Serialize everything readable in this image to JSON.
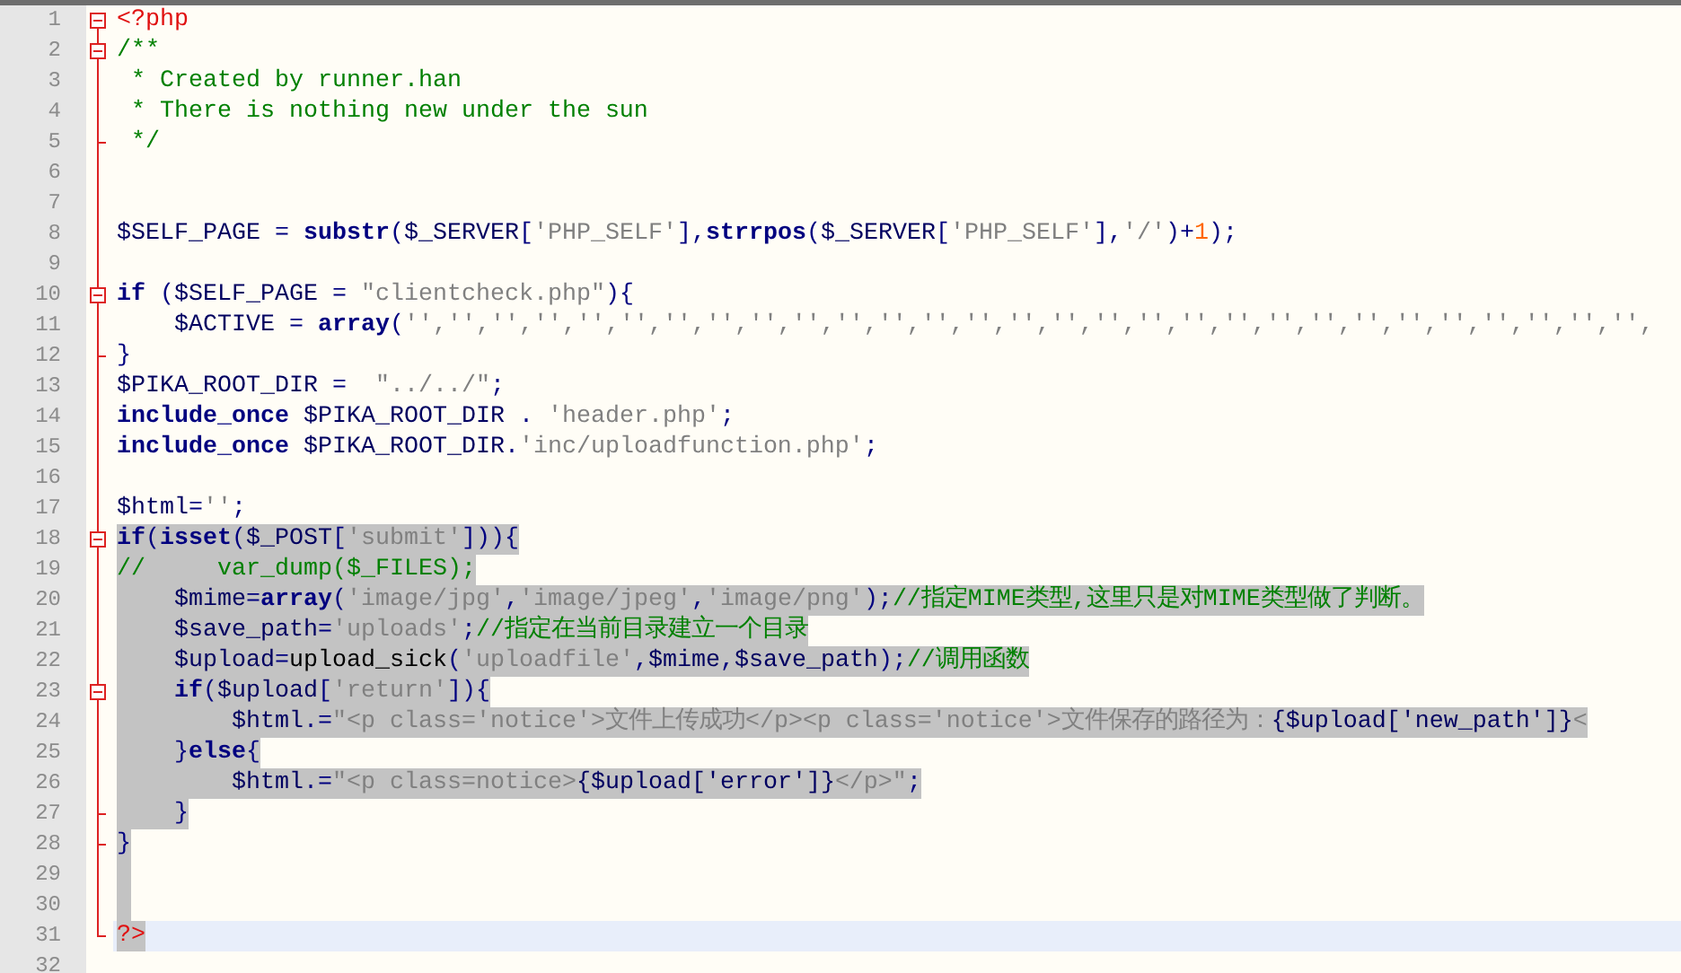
{
  "lines": [
    {
      "number": "1",
      "kind": "start",
      "selected": false,
      "current": false,
      "tokens": [
        {
          "kind": "tag",
          "text": "<?php"
        }
      ]
    },
    {
      "number": "2",
      "kind": "start",
      "selected": false,
      "current": false,
      "tokens": [
        {
          "kind": "comment",
          "text": "/**"
        }
      ]
    },
    {
      "number": "3",
      "kind": "body",
      "selected": false,
      "current": false,
      "tokens": [
        {
          "kind": "comment",
          "text": " * Created by runner.han"
        }
      ]
    },
    {
      "number": "4",
      "kind": "body",
      "selected": false,
      "current": false,
      "tokens": [
        {
          "kind": "comment",
          "text": " * There is nothing new under the sun"
        }
      ]
    },
    {
      "number": "5",
      "kind": "end",
      "selected": false,
      "current": false,
      "tokens": [
        {
          "kind": "comment",
          "text": " */"
        }
      ]
    },
    {
      "number": "6",
      "kind": "body",
      "selected": false,
      "current": false
    },
    {
      "number": "7",
      "kind": "body",
      "selected": false,
      "current": false
    },
    {
      "number": "8",
      "kind": "body",
      "selected": false,
      "current": false,
      "tokens": [
        {
          "kind": "var",
          "text": "$SELF_PAGE"
        },
        {
          "kind": "op",
          "text": " = "
        },
        {
          "kind": "keyword",
          "text": "substr"
        },
        {
          "kind": "op",
          "text": "("
        },
        {
          "kind": "var",
          "text": "$_SERVER"
        },
        {
          "kind": "op",
          "text": "["
        },
        {
          "kind": "string",
          "text": "'PHP_SELF'"
        },
        {
          "kind": "op",
          "text": "],"
        },
        {
          "kind": "keyword",
          "text": "strrpos"
        },
        {
          "kind": "op",
          "text": "("
        },
        {
          "kind": "var",
          "text": "$_SERVER"
        },
        {
          "kind": "op",
          "text": "["
        },
        {
          "kind": "string",
          "text": "'PHP_SELF'"
        },
        {
          "kind": "op",
          "text": "],"
        },
        {
          "kind": "string",
          "text": "'/'"
        },
        {
          "kind": "op",
          "text": ")+"
        },
        {
          "kind": "number",
          "text": "1"
        },
        {
          "kind": "op",
          "text": ");"
        }
      ]
    },
    {
      "number": "9",
      "kind": "body",
      "selected": false,
      "current": false
    },
    {
      "number": "10",
      "kind": "start",
      "selected": false,
      "current": false,
      "tokens": [
        {
          "kind": "keyword",
          "text": "if"
        },
        {
          "kind": "op",
          "text": " ("
        },
        {
          "kind": "var",
          "text": "$SELF_PAGE"
        },
        {
          "kind": "op",
          "text": " = "
        },
        {
          "kind": "string",
          "text": "\"clientcheck.php\""
        },
        {
          "kind": "op",
          "text": "){"
        }
      ]
    },
    {
      "number": "11",
      "kind": "body",
      "selected": false,
      "current": false,
      "tokens": [
        {
          "kind": "var",
          "text": "    $ACTIVE"
        },
        {
          "kind": "op",
          "text": " = "
        },
        {
          "kind": "keyword",
          "text": "array"
        },
        {
          "kind": "op",
          "text": "("
        },
        {
          "kind": "string",
          "text": "'','','','','','','','','','','','','','','','','','','','','','','','','','','','','',"
        }
      ]
    },
    {
      "number": "12",
      "kind": "end",
      "selected": false,
      "current": false,
      "tokens": [
        {
          "kind": "op",
          "text": "}"
        }
      ]
    },
    {
      "number": "13",
      "kind": "body",
      "selected": false,
      "current": false,
      "tokens": [
        {
          "kind": "var",
          "text": "$PIKA_ROOT_DIR"
        },
        {
          "kind": "op",
          "text": " =  "
        },
        {
          "kind": "string",
          "text": "\"../../\""
        },
        {
          "kind": "op",
          "text": ";"
        }
      ]
    },
    {
      "number": "14",
      "kind": "body",
      "selected": false,
      "current": false,
      "tokens": [
        {
          "kind": "keyword",
          "text": "include_once"
        },
        {
          "kind": "var",
          "text": " $PIKA_ROOT_DIR"
        },
        {
          "kind": "op",
          "text": " . "
        },
        {
          "kind": "string",
          "text": "'header.php'"
        },
        {
          "kind": "op",
          "text": ";"
        }
      ]
    },
    {
      "number": "15",
      "kind": "body",
      "selected": false,
      "current": false,
      "tokens": [
        {
          "kind": "keyword",
          "text": "include_once"
        },
        {
          "kind": "var",
          "text": " $PIKA_ROOT_DIR"
        },
        {
          "kind": "op",
          "text": "."
        },
        {
          "kind": "string",
          "text": "'inc/uploadfunction.php'"
        },
        {
          "kind": "op",
          "text": ";"
        }
      ]
    },
    {
      "number": "16",
      "kind": "body",
      "selected": false,
      "current": false
    },
    {
      "number": "17",
      "kind": "body",
      "selected": false,
      "current": false,
      "tokens": [
        {
          "kind": "var",
          "text": "$html"
        },
        {
          "kind": "op",
          "text": "="
        },
        {
          "kind": "string",
          "text": "''"
        },
        {
          "kind": "op",
          "text": ";"
        }
      ]
    },
    {
      "number": "18",
      "kind": "start",
      "selected": true,
      "current": false,
      "tokens": [
        {
          "kind": "keyword",
          "text": "if"
        },
        {
          "kind": "op",
          "text": "("
        },
        {
          "kind": "keyword",
          "text": "isset"
        },
        {
          "kind": "op",
          "text": "("
        },
        {
          "kind": "var",
          "text": "$_POST"
        },
        {
          "kind": "op",
          "text": "["
        },
        {
          "kind": "string",
          "text": "'submit'"
        },
        {
          "kind": "op",
          "text": "])){"
        }
      ]
    },
    {
      "number": "19",
      "kind": "body",
      "selected": true,
      "current": false,
      "tokens": [
        {
          "kind": "comment",
          "text": "//     var_dump($_FILES);"
        }
      ]
    },
    {
      "number": "20",
      "kind": "body",
      "selected": true,
      "current": false,
      "tokens": [
        {
          "kind": "var",
          "text": "    $mime"
        },
        {
          "kind": "op",
          "text": "="
        },
        {
          "kind": "keyword",
          "text": "array"
        },
        {
          "kind": "op",
          "text": "("
        },
        {
          "kind": "string",
          "text": "'image/jpg'"
        },
        {
          "kind": "op",
          "text": ","
        },
        {
          "kind": "string",
          "text": "'image/jpeg'"
        },
        {
          "kind": "op",
          "text": ","
        },
        {
          "kind": "string",
          "text": "'image/png'"
        },
        {
          "kind": "op",
          "text": ");"
        },
        {
          "kind": "comment",
          "text": "//指定MIME类型,这里只是对MIME类型做了判断。"
        }
      ]
    },
    {
      "number": "21",
      "kind": "body",
      "selected": true,
      "current": false,
      "tokens": [
        {
          "kind": "var",
          "text": "    $save_path"
        },
        {
          "kind": "op",
          "text": "="
        },
        {
          "kind": "string",
          "text": "'uploads'"
        },
        {
          "kind": "op",
          "text": ";"
        },
        {
          "kind": "comment",
          "text": "//指定在当前目录建立一个目录"
        }
      ]
    },
    {
      "number": "22",
      "kind": "body",
      "selected": true,
      "current": false,
      "tokens": [
        {
          "kind": "var",
          "text": "    $upload"
        },
        {
          "kind": "op",
          "text": "="
        },
        {
          "kind": "plain",
          "text": "upload_sick"
        },
        {
          "kind": "op",
          "text": "("
        },
        {
          "kind": "string",
          "text": "'uploadfile'"
        },
        {
          "kind": "op",
          "text": ","
        },
        {
          "kind": "var",
          "text": "$mime"
        },
        {
          "kind": "op",
          "text": ","
        },
        {
          "kind": "var",
          "text": "$save_path"
        },
        {
          "kind": "op",
          "text": ");"
        },
        {
          "kind": "comment",
          "text": "//调用函数"
        }
      ]
    },
    {
      "number": "23",
      "kind": "start",
      "selected": true,
      "current": false,
      "tokens": [
        {
          "kind": "keyword",
          "text": "    if"
        },
        {
          "kind": "op",
          "text": "("
        },
        {
          "kind": "var",
          "text": "$upload"
        },
        {
          "kind": "op",
          "text": "["
        },
        {
          "kind": "string",
          "text": "'return'"
        },
        {
          "kind": "op",
          "text": "]){"
        }
      ]
    },
    {
      "number": "24",
      "kind": "body",
      "selected": true,
      "current": false,
      "tokens": [
        {
          "kind": "var",
          "text": "        $html"
        },
        {
          "kind": "op",
          "text": ".="
        },
        {
          "kind": "string",
          "text": "\"<p class='notice'>文件上传成功</p><p class='notice'>文件保存的路径为："
        },
        {
          "kind": "var",
          "text": "{$upload['new_path']}"
        },
        {
          "kind": "string",
          "text": "<"
        }
      ]
    },
    {
      "number": "25",
      "kind": "body",
      "selected": true,
      "current": false,
      "tokens": [
        {
          "kind": "op",
          "text": "    }"
        },
        {
          "kind": "keyword",
          "text": "else"
        },
        {
          "kind": "op",
          "text": "{"
        }
      ]
    },
    {
      "number": "26",
      "kind": "body",
      "selected": true,
      "current": false,
      "tokens": [
        {
          "kind": "var",
          "text": "        $html"
        },
        {
          "kind": "op",
          "text": ".="
        },
        {
          "kind": "string",
          "text": "\"<p class=notice>"
        },
        {
          "kind": "var",
          "text": "{$upload['error']}"
        },
        {
          "kind": "string",
          "text": "</p>\""
        },
        {
          "kind": "op",
          "text": ";"
        }
      ]
    },
    {
      "number": "27",
      "kind": "end",
      "selected": true,
      "current": false,
      "tokens": [
        {
          "kind": "op",
          "text": "    }"
        }
      ]
    },
    {
      "number": "28",
      "kind": "end",
      "selected": true,
      "current": false,
      "tokens": [
        {
          "kind": "op",
          "text": "}"
        }
      ]
    },
    {
      "number": "29",
      "kind": "body",
      "selected": true,
      "current": false
    },
    {
      "number": "30",
      "kind": "body",
      "selected": true,
      "current": false
    },
    {
      "number": "31",
      "kind": "end",
      "selected": true,
      "current": true,
      "tokens": [
        {
          "kind": "tag",
          "text": "?>"
        }
      ]
    },
    {
      "number": "32",
      "kind": "plain",
      "selected": false,
      "current": false
    }
  ]
}
